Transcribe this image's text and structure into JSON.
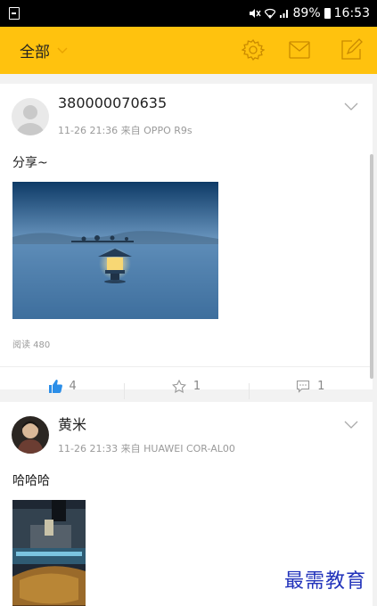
{
  "status_bar": {
    "battery": "89%",
    "time": "16:53"
  },
  "app_bar": {
    "filter_label": "全部",
    "icons": [
      "chevron-down-icon",
      "gear-icon",
      "mail-icon",
      "compose-icon"
    ]
  },
  "posts": [
    {
      "username": "380000070635",
      "meta": "11-26 21:36  来自 OPPO R9s",
      "text": "分享~",
      "reads": "阅读 480",
      "likes": "4",
      "stars": "1",
      "comments": "1"
    },
    {
      "username": "黄米",
      "meta": "11-26 21:33  来自 HUAWEI COR-AL00",
      "text": "哈哈哈"
    }
  ],
  "watermark": "最需教育",
  "colors": {
    "app_bar": "#ffc20e",
    "like_blue": "#2b8ee8",
    "watermark": "#2233bb"
  }
}
